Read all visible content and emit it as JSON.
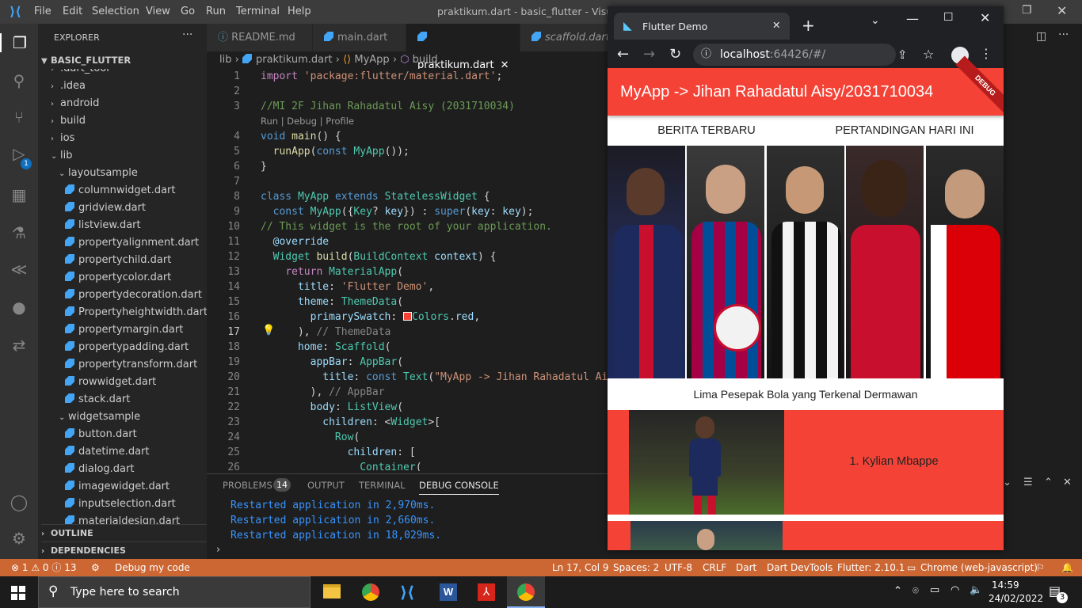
{
  "vscode": {
    "menu": [
      "File",
      "Edit",
      "Selection",
      "View",
      "Go",
      "Run",
      "Terminal",
      "Help"
    ],
    "window_title": "praktikum.dart - basic_flutter - Visual Stu",
    "explorer_label": "EXPLORER",
    "project_name": "BASIC_FLUTTER",
    "tree": [
      {
        "label": ".dart_tool",
        "indent": 1,
        "type": "folder"
      },
      {
        "label": ".idea",
        "indent": 1,
        "type": "folder"
      },
      {
        "label": "android",
        "indent": 1,
        "type": "folder"
      },
      {
        "label": "build",
        "indent": 1,
        "type": "folder"
      },
      {
        "label": "ios",
        "indent": 1,
        "type": "folder"
      },
      {
        "label": "lib",
        "indent": 1,
        "type": "folder-open"
      },
      {
        "label": "layoutsample",
        "indent": 2,
        "type": "folder-open"
      },
      {
        "label": "columnwidget.dart",
        "indent": 3,
        "type": "file"
      },
      {
        "label": "gridview.dart",
        "indent": 3,
        "type": "file"
      },
      {
        "label": "listview.dart",
        "indent": 3,
        "type": "file"
      },
      {
        "label": "propertyalignment.dart",
        "indent": 3,
        "type": "file"
      },
      {
        "label": "propertychild.dart",
        "indent": 3,
        "type": "file"
      },
      {
        "label": "propertycolor.dart",
        "indent": 3,
        "type": "file"
      },
      {
        "label": "propertydecoration.dart",
        "indent": 3,
        "type": "file"
      },
      {
        "label": "Propertyheightwidth.dart",
        "indent": 3,
        "type": "file"
      },
      {
        "label": "propertymargin.dart",
        "indent": 3,
        "type": "file"
      },
      {
        "label": "propertypadding.dart",
        "indent": 3,
        "type": "file"
      },
      {
        "label": "propertytransform.dart",
        "indent": 3,
        "type": "file"
      },
      {
        "label": "rowwidget.dart",
        "indent": 3,
        "type": "file"
      },
      {
        "label": "stack.dart",
        "indent": 3,
        "type": "file"
      },
      {
        "label": "widgetsample",
        "indent": 2,
        "type": "folder-open"
      },
      {
        "label": "button.dart",
        "indent": 3,
        "type": "file"
      },
      {
        "label": "datetime.dart",
        "indent": 3,
        "type": "file"
      },
      {
        "label": "dialog.dart",
        "indent": 3,
        "type": "file"
      },
      {
        "label": "imagewidget.dart",
        "indent": 3,
        "type": "file"
      },
      {
        "label": "inputselection.dart",
        "indent": 3,
        "type": "file"
      },
      {
        "label": "materialdesign.dart",
        "indent": 3,
        "type": "file"
      }
    ],
    "outline_label": "OUTLINE",
    "dependencies_label": "DEPENDENCIES",
    "tabs": [
      "README.md",
      "main.dart",
      "praktikum.dart",
      "scaffold.dart"
    ],
    "breadcrumb": [
      "lib",
      "praktikum.dart",
      "MyApp",
      "build"
    ],
    "codelens": "Run | Debug | Profile",
    "panel_tabs": [
      "PROBLEMS",
      "OUTPUT",
      "TERMINAL",
      "DEBUG CONSOLE"
    ],
    "problems_count": "14",
    "console_lines": [
      "Restarted application in 2,970ms.",
      "Restarted application in 2,660ms.",
      "Restarted application in 18,029ms."
    ],
    "badge_count": "1",
    "status": {
      "errors": "1",
      "warnings": "0",
      "infos": "13",
      "debug": "Debug my code",
      "position": "Ln 17, Col 9",
      "spaces": "Spaces: 2",
      "encoding": "UTF-8",
      "eol": "CRLF",
      "language": "Dart",
      "devtools": "Dart DevTools",
      "flutter": "Flutter: 2.10.1",
      "device": "Chrome (web-javascript)"
    }
  },
  "browser": {
    "tab_title": "Flutter Demo",
    "url_host": "localhost",
    "url_rest": ":64426/#/",
    "app_title": "MyApp -> Jihan Rahadatul Aisy/2031710034",
    "debug_banner": "DEBUG",
    "header_left": "BERITA TERBARU",
    "header_right": "PERTANDINGAN HARI INI",
    "caption": "Lima Pesepak Bola yang Terkenal Dermawan",
    "list": [
      {
        "name": "1. Kylian Mbappe"
      }
    ]
  },
  "taskbar": {
    "search_placeholder": "Type here to search",
    "time": "14:59",
    "date": "24/02/2022",
    "notifications": "3"
  }
}
